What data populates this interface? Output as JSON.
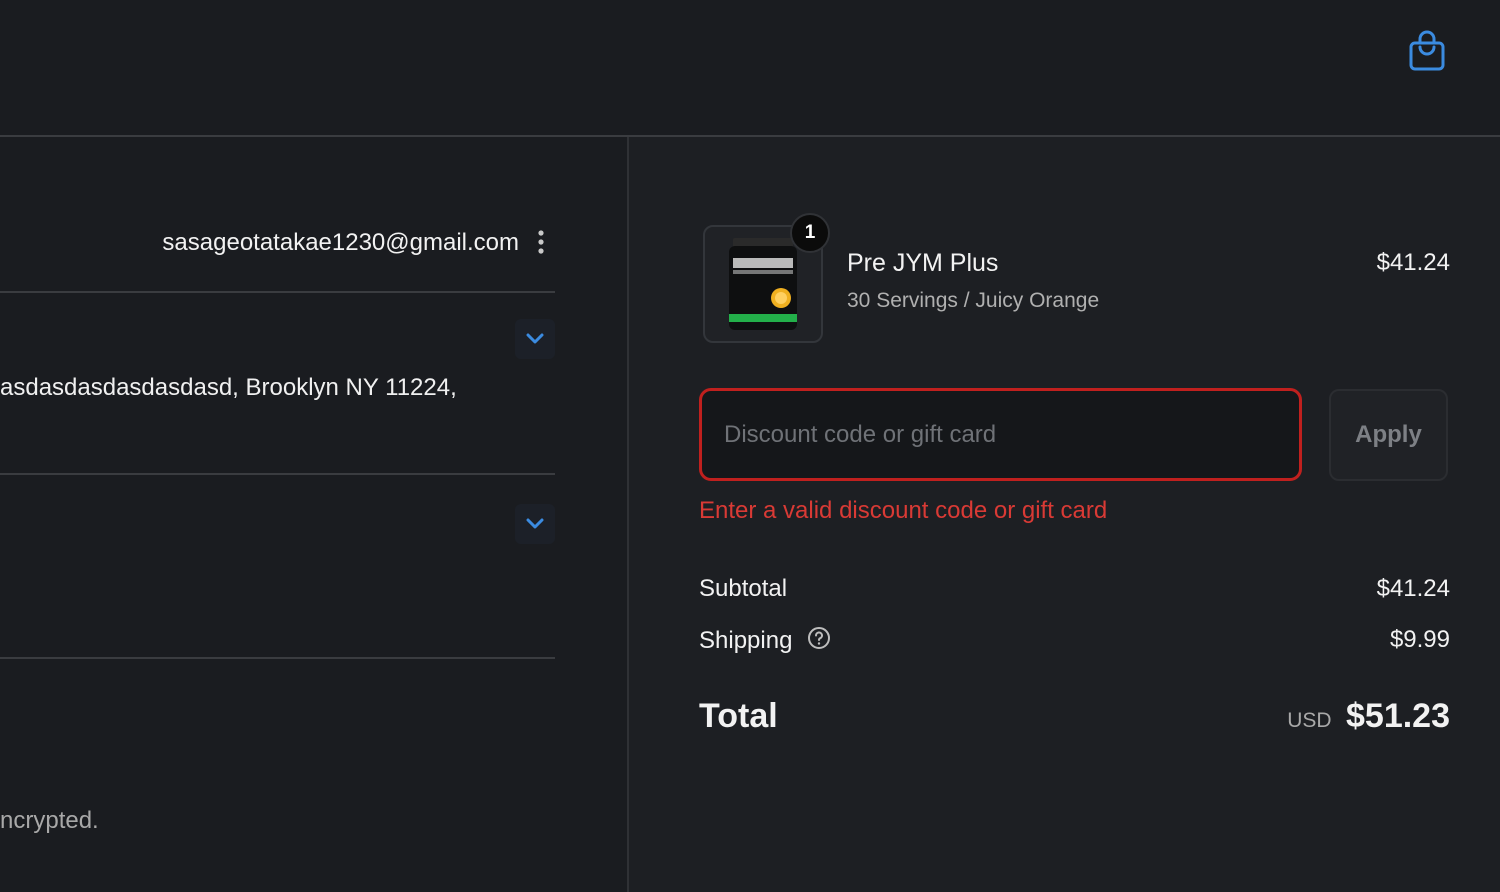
{
  "header": {
    "bag_icon": "shopping-bag-icon",
    "accent_color": "#3b8be0"
  },
  "contact": {
    "email": "sasageotatakae1230@gmail.com",
    "menu_icon": "kebab-menu-icon"
  },
  "shipping_address": {
    "text": "asdasdasdasdasdasd, Brooklyn NY 11224,"
  },
  "security_note": {
    "text": "ncrypted."
  },
  "order": {
    "item": {
      "name": "Pre JYM Plus",
      "variant": "30 Servings / Juicy Orange",
      "price": "$41.24",
      "quantity": "1"
    },
    "discount": {
      "placeholder": "Discount code or gift card",
      "value": "",
      "apply_label": "Apply",
      "error": "Enter a valid discount code or gift card",
      "error_color": "#d93a35"
    },
    "subtotal_label": "Subtotal",
    "subtotal_value": "$41.24",
    "shipping_label": "Shipping",
    "shipping_value": "$9.99",
    "total_label": "Total",
    "currency": "USD",
    "total_value": "$51.23"
  }
}
